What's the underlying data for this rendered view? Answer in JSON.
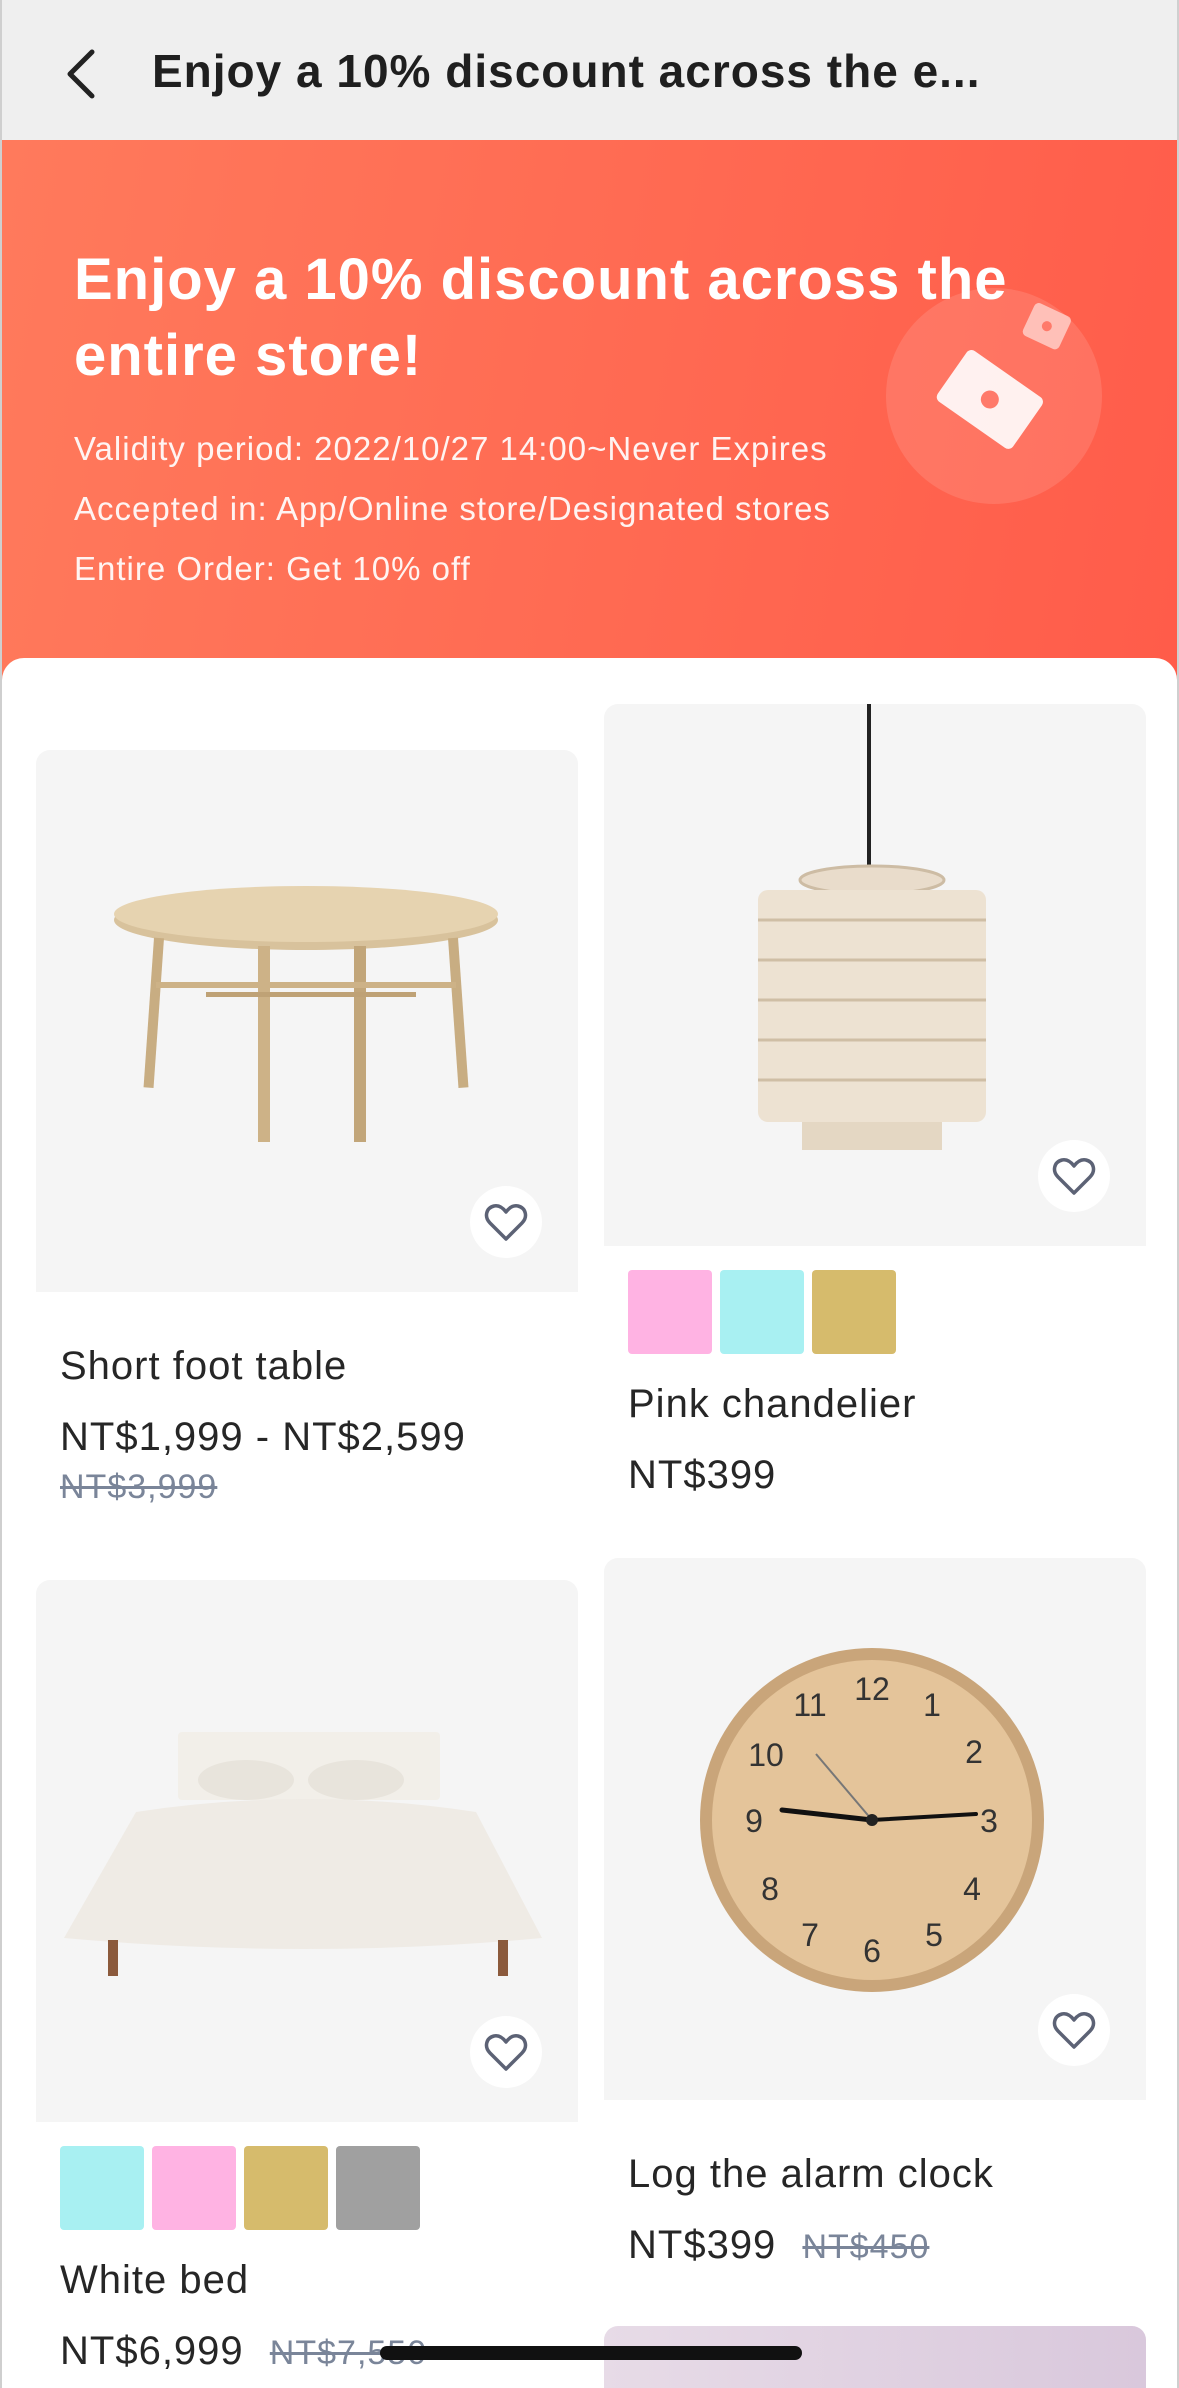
{
  "nav": {
    "title": "Enjoy a 10% discount across the e..."
  },
  "banner": {
    "headline": "Enjoy a 10% discount across the entire store!",
    "validity": "Validity period: 2022/10/27 14:00~Never Expires",
    "accepted": "Accepted in: App/Online store/Designated stores",
    "offer": "Entire Order: Get 10% off",
    "colors": {
      "start": "#ff7a5c",
      "end": "#ff5c4a"
    }
  },
  "products": [
    {
      "name": "Short foot table",
      "price": "NT$1,999 - NT$2,599",
      "old_price": "NT$3,999",
      "swatches": []
    },
    {
      "name": "Pink chandelier",
      "price": "NT$399",
      "old_price": "",
      "swatches": [
        "#ffb3e3",
        "#a8f0f2",
        "#d6bb6c"
      ]
    },
    {
      "name": "White bed",
      "price": "NT$6,999",
      "old_price": "NT$7,550",
      "swatches": [
        "#a8f0f2",
        "#ffb3e3",
        "#d6bb6c",
        "#a0a0a0"
      ]
    },
    {
      "name": "Log the alarm clock",
      "price": "NT$399",
      "old_price": "NT$450",
      "swatches": []
    }
  ],
  "clock": {
    "numbers": [
      "12",
      "1",
      "2",
      "3",
      "4",
      "5",
      "6",
      "7",
      "8",
      "9",
      "10",
      "11"
    ]
  }
}
